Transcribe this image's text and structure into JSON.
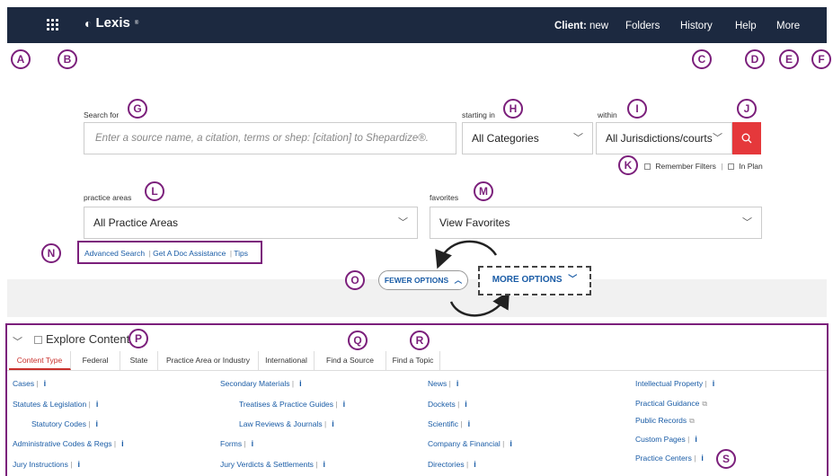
{
  "nav": {
    "brand": "Lexis",
    "brand_mark": "®",
    "client_label": "Client:",
    "client_value": "new",
    "folders": "Folders",
    "history": "History",
    "help": "Help",
    "more": "More"
  },
  "markers": [
    "A",
    "B",
    "C",
    "D",
    "E",
    "F",
    "G",
    "H",
    "I",
    "J",
    "K",
    "L",
    "M",
    "N",
    "O",
    "P",
    "Q",
    "R",
    "S"
  ],
  "search": {
    "label": "Search for",
    "placeholder": "Enter a source name, a citation, terms or shep: [citation] to Shepardize®.",
    "starting_in_label": "starting in",
    "starting_in_value": "All Categories",
    "within_label": "within",
    "within_value": "All Jurisdictions/courts",
    "remember_filters": "Remember Filters",
    "in_plan": "In Plan"
  },
  "filters": {
    "practice_areas_label": "practice areas",
    "practice_areas_value": "All Practice Areas",
    "favorites_label": "favorites",
    "favorites_value": "View Favorites"
  },
  "links": {
    "advanced_search": "Advanced Search",
    "get_a_doc": "Get A Doc Assistance",
    "tips": "Tips"
  },
  "options": {
    "fewer": "FEWER OPTIONS",
    "more": "MORE OPTIONS"
  },
  "explore": {
    "title": "Explore Content",
    "tabs": [
      "Content Type",
      "Federal",
      "State",
      "Practice Area or Industry",
      "International",
      "Find a Source",
      "Find a Topic"
    ],
    "col1": [
      "Cases",
      "Statutes & Legislation",
      "Statutory Codes",
      "Administrative Codes & Regs",
      "Jury Instructions"
    ],
    "col2": [
      "Secondary Materials",
      "Treatises & Practice Guides",
      "Law Reviews & Journals",
      "Forms",
      "Jury Verdicts & Settlements"
    ],
    "col3": [
      "News",
      "Dockets",
      "Scientific",
      "Company & Financial",
      "Directories"
    ],
    "col4": [
      "Intellectual Property",
      "Practical Guidance",
      "Public Records",
      "Custom Pages",
      "Practice Centers"
    ]
  },
  "colors": {
    "nav_bg": "#1c2940",
    "marker": "#7b1f7b",
    "search_button": "#e5383b",
    "link": "#1a5ca6",
    "active_tab": "#c9302c"
  }
}
